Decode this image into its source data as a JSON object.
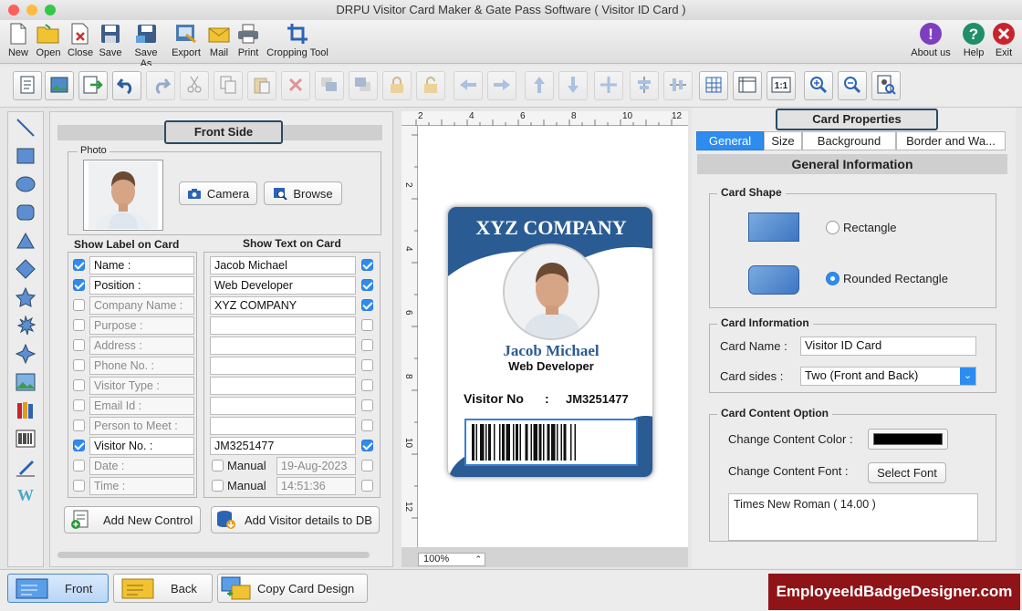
{
  "window": {
    "title": "DRPU Visitor Card Maker & Gate Pass Software ( Visitor ID Card )"
  },
  "menu": {
    "new": "New",
    "open": "Open",
    "close": "Close",
    "save": "Save",
    "save_as": "Save As",
    "export": "Export",
    "mail": "Mail",
    "print": "Print",
    "cropping_tool": "Cropping Tool",
    "about": "About us",
    "help": "Help",
    "exit": "Exit"
  },
  "front": {
    "title": "Front Side",
    "photo_label": "Photo",
    "camera": "Camera",
    "browse": "Browse",
    "show_label_header": "Show Label on Card",
    "show_text_header": "Show Text on Card",
    "rows": [
      {
        "label": "Name :",
        "label_checked": true,
        "value": "Jacob Michael",
        "value_checked": true
      },
      {
        "label": "Position :",
        "label_checked": true,
        "value": "Web Developer",
        "value_checked": true
      },
      {
        "label": "Company Name :",
        "label_checked": false,
        "value": "XYZ COMPANY",
        "value_checked": true
      },
      {
        "label": "Purpose :",
        "label_checked": false,
        "value": "",
        "value_checked": false
      },
      {
        "label": "Address :",
        "label_checked": false,
        "value": "",
        "value_checked": false
      },
      {
        "label": "Phone No. :",
        "label_checked": false,
        "value": "",
        "value_checked": false
      },
      {
        "label": "Visitor Type :",
        "label_checked": false,
        "value": "",
        "value_checked": false
      },
      {
        "label": "Email Id :",
        "label_checked": false,
        "value": "",
        "value_checked": false
      },
      {
        "label": "Person to Meet :",
        "label_checked": false,
        "value": "",
        "value_checked": false
      },
      {
        "label": "Visitor No. :",
        "label_checked": true,
        "value": "JM3251477",
        "value_checked": true
      },
      {
        "label": "Date :",
        "label_checked": false,
        "manual": "Manual",
        "value": "19-Aug-2023",
        "value_checked": false
      },
      {
        "label": "Time :",
        "label_checked": false,
        "manual": "Manual",
        "value": "14:51:36",
        "value_checked": false
      }
    ],
    "add_new_control": "Add New Control",
    "add_visitor_db": "Add Visitor details to DB"
  },
  "canvas": {
    "zoom": "100%",
    "ruler_marks": [
      "2",
      "4",
      "6",
      "8",
      "10",
      "12"
    ],
    "ruler_v_marks": [
      "2",
      "4",
      "6",
      "8",
      "10",
      "12"
    ]
  },
  "card": {
    "company": "XYZ COMPANY",
    "name": "Jacob Michael",
    "position": "Web Developer",
    "visitor_label": "Visitor No",
    "visitor_sep": ":",
    "visitor_no": "JM3251477",
    "primary_color": "#2a5b93"
  },
  "props": {
    "title": "Card Properties",
    "tabs": [
      "General",
      "Size",
      "Background",
      "Border and Wa..."
    ],
    "section_title": "General Information",
    "card_shape_legend": "Card Shape",
    "shape_rect": "Rectangle",
    "shape_rounded": "Rounded Rectangle",
    "card_info_legend": "Card Information",
    "card_name_label": "Card Name :",
    "card_name_value": "Visitor ID Card",
    "card_sides_label": "Card sides :",
    "card_sides_value": "Two (Front and Back)",
    "content_legend": "Card Content Option",
    "content_color_label": "Change Content Color :",
    "content_color": "#000000",
    "content_font_label": "Change Content Font :",
    "select_font": "Select Font",
    "font_value": "Times New Roman ( 14.00 )"
  },
  "bottom": {
    "front": "Front",
    "back": "Back",
    "copy_design": "Copy Card Design",
    "brand": "EmployeeIdBadgeDesigner.com"
  }
}
